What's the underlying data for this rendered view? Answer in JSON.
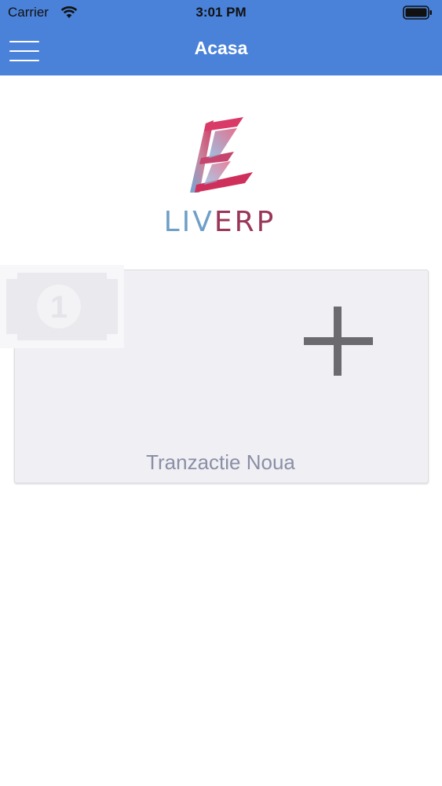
{
  "status_bar": {
    "carrier": "Carrier",
    "time": "3:01 PM"
  },
  "nav": {
    "title": "Acasa",
    "menu_icon": "hamburger-menu-icon"
  },
  "logo": {
    "text_part1": "LIV",
    "text_part2": "ERP",
    "icon": "liverp-logo-mark"
  },
  "card": {
    "label": "Tranzactie Noua",
    "icons": [
      "money-bill-icon",
      "plus-icon"
    ]
  },
  "colors": {
    "header": "#4a82d9",
    "card_bg": "#efeff4",
    "label": "#8a8fa5",
    "plus": "#6b6b6f",
    "logo_blue": "#6f9fc7",
    "logo_red": "#9a3658"
  }
}
